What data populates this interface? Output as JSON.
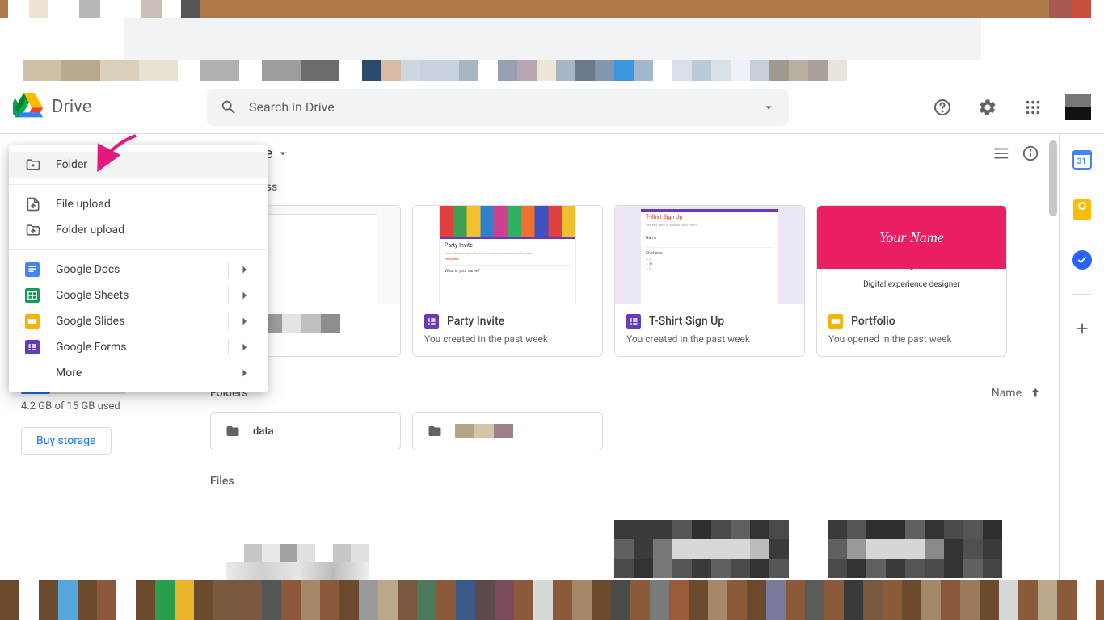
{
  "app": {
    "name": "Drive"
  },
  "search": {
    "placeholder": "Search in Drive"
  },
  "breadcrumb": {
    "visible_suffix": "e"
  },
  "sections": {
    "quick_access_suffix": "ess",
    "folders": "Folders",
    "files": "Files"
  },
  "sort": {
    "label": "Name"
  },
  "storage": {
    "text": "4.2 GB of 15 GB used",
    "buy": "Buy storage",
    "percent": 28
  },
  "menu": {
    "folder": "Folder",
    "file_upload": "File upload",
    "folder_upload": "Folder upload",
    "docs": "Google Docs",
    "sheets": "Google Sheets",
    "slides": "Google Slides",
    "forms": "Google Forms",
    "more": "More"
  },
  "cards": [
    {
      "title": "",
      "sub": "",
      "icon": "docs",
      "thumb": "mosaic"
    },
    {
      "title": "Party Invite",
      "sub": "You created in the past week",
      "icon": "forms",
      "thumb": "party"
    },
    {
      "title": "T-Shirt Sign Up",
      "sub": "You created in the past week",
      "icon": "forms",
      "thumb": "tshirt"
    },
    {
      "title": "Portfolio",
      "sub": "You opened in the past week",
      "icon": "slides",
      "thumb": "portfolio"
    }
  ],
  "portfolio_thumb": {
    "line1": "Your Name",
    "line2": "Digital experience designer"
  },
  "tshirt_thumb": {
    "title": "T-Shirt Sign Up",
    "field1": "Name",
    "field2": "Shirt size"
  },
  "party_thumb": {
    "title": "Party Invite",
    "q": "What is your name?"
  },
  "folders_list": [
    {
      "name": "data"
    },
    {
      "name": ""
    }
  ],
  "side_panel": {
    "calendar_day": "31"
  },
  "colors": {
    "forms_purple": "#673ab7",
    "docs_blue": "#4285f4",
    "sheets_green": "#0f9d58",
    "slides_yellow": "#f4b400",
    "pink": "#e91e63"
  }
}
